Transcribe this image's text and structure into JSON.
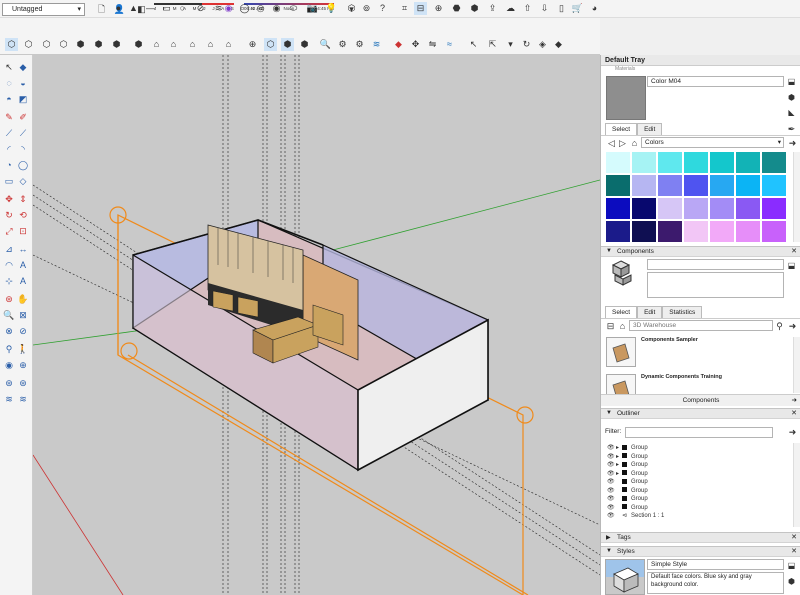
{
  "toolbar_top": {
    "tag_select": "Untagged",
    "months": "J F M A M J J A S O N D",
    "sun": {
      "start": "06:43 AM",
      "mid": "Noon",
      "end": "04:45 PM"
    }
  },
  "tray": {
    "title": "Default Tray",
    "materials": {
      "partial_header": "Materials",
      "name": "Color M04",
      "tabs": [
        "Select",
        "Edit"
      ],
      "library": "Colors",
      "swatches": [
        "#d5fbfd",
        "#a6f3f4",
        "#5fe8ee",
        "#2fd9de",
        "#14c7cc",
        "#12b3b6",
        "#148b8c",
        "#0a6d6d",
        "#b6b6f2",
        "#7f80f2",
        "#4f54f0",
        "#27a8f2",
        "#0bb4f5",
        "#20c3ff",
        "#0c0cbf",
        "#08086e",
        "#d6c6f6",
        "#b9a7f5",
        "#a38cf6",
        "#8a59f3",
        "#8a2cff",
        "#1b1b8a",
        "#0f0f52",
        "#3c1a6d",
        "#f2c6f6",
        "#f2a9f8",
        "#e68ef9",
        "#c861fb"
      ]
    },
    "components": {
      "header": "Components",
      "tabs": [
        "Select",
        "Edit",
        "Statistics"
      ],
      "search_placeholder": "3D Warehouse",
      "items": [
        {
          "title": "Components Sampler"
        },
        {
          "title": "Dynamic Components Training"
        }
      ],
      "footer": "Components"
    },
    "outliner": {
      "header": "Outliner",
      "filter_label": "Filter:",
      "rows": [
        {
          "label": "Group",
          "expand": true
        },
        {
          "label": "Group",
          "expand": true
        },
        {
          "label": "Group",
          "expand": true
        },
        {
          "label": "Group",
          "expand": true
        },
        {
          "label": "Group",
          "expand": false
        },
        {
          "label": "Group",
          "expand": false
        },
        {
          "label": "Group",
          "expand": false
        },
        {
          "label": "Group",
          "expand": false
        },
        {
          "label": "Section 1 : 1",
          "expand": false,
          "section": true
        }
      ]
    },
    "tags": {
      "header": "Tags"
    },
    "styles": {
      "header": "Styles",
      "name": "Simple Style",
      "description": "Default face colors. Blue sky and gray background color."
    }
  }
}
